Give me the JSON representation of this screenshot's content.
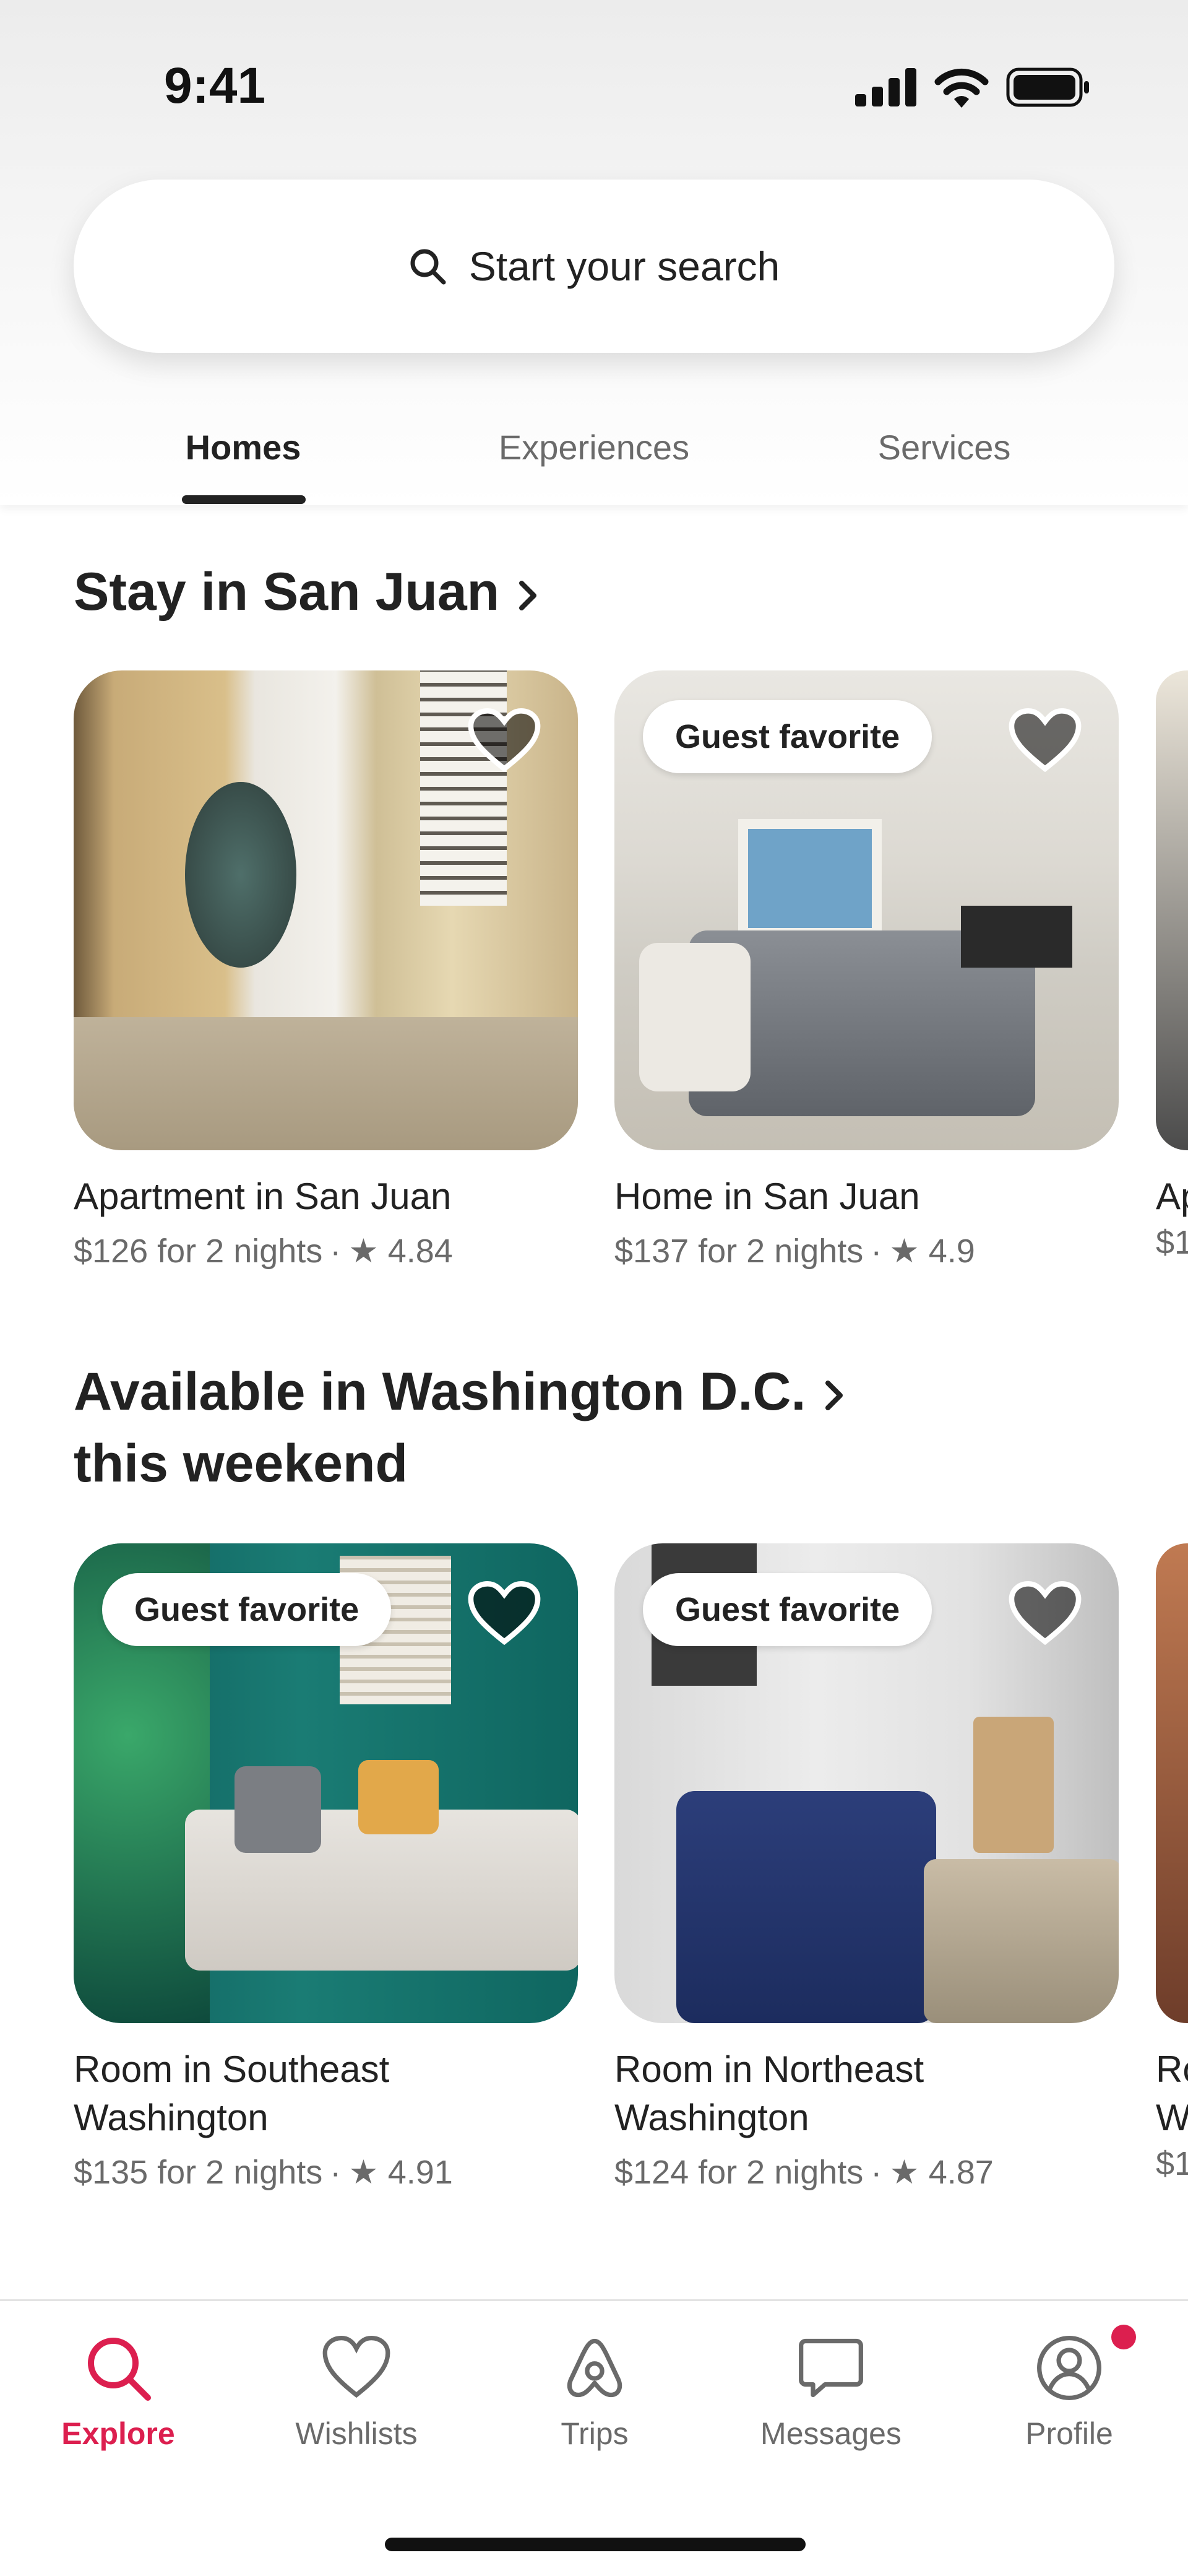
{
  "status_bar": {
    "time": "9:41"
  },
  "search": {
    "label": "Start your search"
  },
  "tabs": [
    {
      "label": "Homes",
      "active": true
    },
    {
      "label": "Experiences",
      "active": false
    },
    {
      "label": "Services",
      "active": false
    }
  ],
  "sections": [
    {
      "title": "Stay in San Juan",
      "cards": [
        {
          "title": "Apartment in San Juan",
          "price": "$126 for 2 nights",
          "rating": "4.84",
          "badge": ""
        },
        {
          "title": "Home in San Juan",
          "price": "$137 for 2 nights",
          "rating": "4.9",
          "badge": "Guest favorite"
        }
      ],
      "peek": {
        "title": "Ap",
        "price": "$1"
      }
    },
    {
      "title_line1": "Available in Washington D.C.",
      "title_line2": "this weekend",
      "cards": [
        {
          "title_line1": "Room in Southeast",
          "title_line2": "Washington",
          "price": "$135 for 2 nights",
          "rating": "4.91",
          "badge": "Guest favorite"
        },
        {
          "title_line1": "Room in Northeast",
          "title_line2": "Washington",
          "price": "$124 for 2 nights",
          "rating": "4.87",
          "badge": "Guest favorite"
        }
      ],
      "peek": {
        "title_line1": "Ro",
        "title_line2": "W",
        "price": "$1"
      }
    }
  ],
  "bottom_nav": [
    {
      "label": "Explore",
      "icon": "search-icon",
      "active": true
    },
    {
      "label": "Wishlists",
      "icon": "heart-icon",
      "active": false
    },
    {
      "label": "Trips",
      "icon": "airbnb-logo-icon",
      "active": false
    },
    {
      "label": "Messages",
      "icon": "message-icon",
      "active": false
    },
    {
      "label": "Profile",
      "icon": "profile-icon",
      "active": false
    }
  ],
  "colors": {
    "accent": "#dc1f4f",
    "text": "#222222",
    "muted": "#6a6a6a"
  }
}
